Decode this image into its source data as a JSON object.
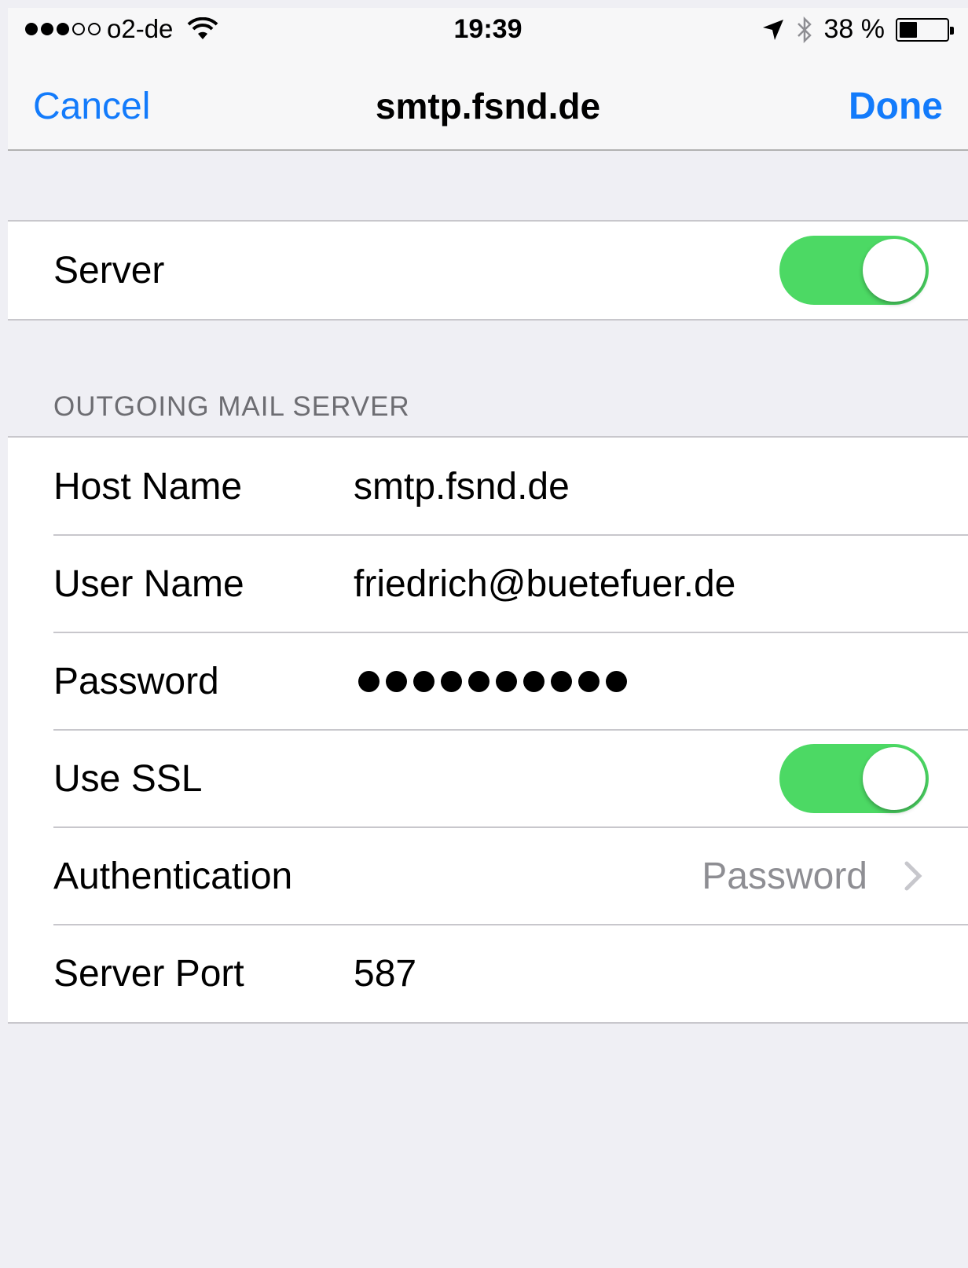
{
  "status_bar": {
    "carrier": "o2-de",
    "time": "19:39",
    "battery_percent": "38 %",
    "battery_level": 0.38,
    "signal_bars_filled": 3,
    "signal_bars_total": 5
  },
  "nav": {
    "cancel_label": "Cancel",
    "title": "smtp.fsnd.de",
    "done_label": "Done"
  },
  "server_group": {
    "server_label": "Server",
    "server_enabled": true
  },
  "outgoing": {
    "section_header": "OUTGOING MAIL SERVER",
    "host_label": "Host Name",
    "host_value": "smtp.fsnd.de",
    "user_label": "User Name",
    "user_value": "friedrich@buetefuer.de",
    "password_label": "Password",
    "password_length": 10,
    "ssl_label": "Use SSL",
    "ssl_enabled": true,
    "auth_label": "Authentication",
    "auth_value": "Password",
    "port_label": "Server Port",
    "port_value": "587"
  },
  "colors": {
    "accent": "#137bfb",
    "toggle_on": "#4cd964",
    "background": "#efeff4",
    "secondary_text": "#8e8e93"
  },
  "icons": {
    "wifi": "wifi-icon",
    "location": "location-arrow-icon",
    "bluetooth": "bluetooth-icon",
    "battery": "battery-icon",
    "chevron": "chevron-right-icon"
  }
}
